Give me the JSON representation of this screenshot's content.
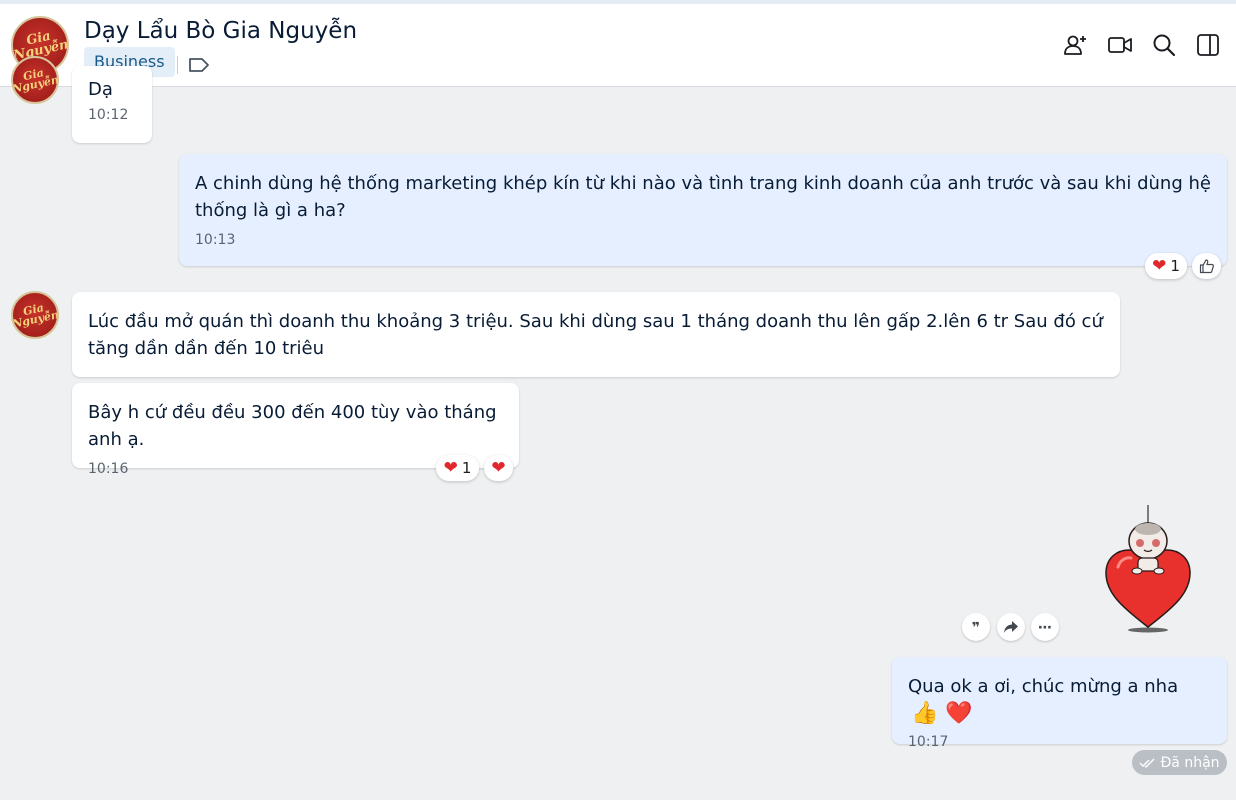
{
  "header": {
    "title": "Dạy Lẩu Bò Gia Nguyễn",
    "badge": "Business",
    "avatar_logo_text": "Gia Nguyễn",
    "icons": [
      "add-member-icon",
      "video-call-icon",
      "search-icon",
      "sidebar-toggle-icon",
      "tag-icon"
    ]
  },
  "messages": [
    {
      "sender": "contact",
      "text": "Dạ",
      "time": "10:12"
    },
    {
      "sender": "me",
      "text": "A chinh dùng hệ thống marketing khép kín từ khi nào và tình trang kinh doanh của anh trước và sau khi dùng hệ thống là gì a ha?",
      "time": "10:13",
      "reaction_count": "1"
    },
    {
      "sender": "contact",
      "text": "Lúc đầu mở quán thì doanh thu khoảng 3 triệu. Sau khi dùng sau 1 tháng doanh thu lên gấp  2.lên 6 tr  Sau đó cứ tăng dần dần  đến 10 triêu"
    },
    {
      "sender": "contact",
      "text": "Bây h cứ đều đều 300 đến 400 tùy vào tháng anh ạ.",
      "time": "10:16",
      "reaction_count": "1"
    },
    {
      "sender": "me",
      "type": "sticker",
      "sticker": "heart-character-sticker"
    },
    {
      "sender": "me",
      "text": "Qua ok a ơi, chúc mừng a nha",
      "emoji": "👍 ❤️",
      "time": "10:17"
    }
  ],
  "status": {
    "received": "Đã nhận"
  },
  "colors": {
    "accent": "#1a5a8a",
    "my_bubble": "#e5efff",
    "heart": "#e0282e"
  }
}
